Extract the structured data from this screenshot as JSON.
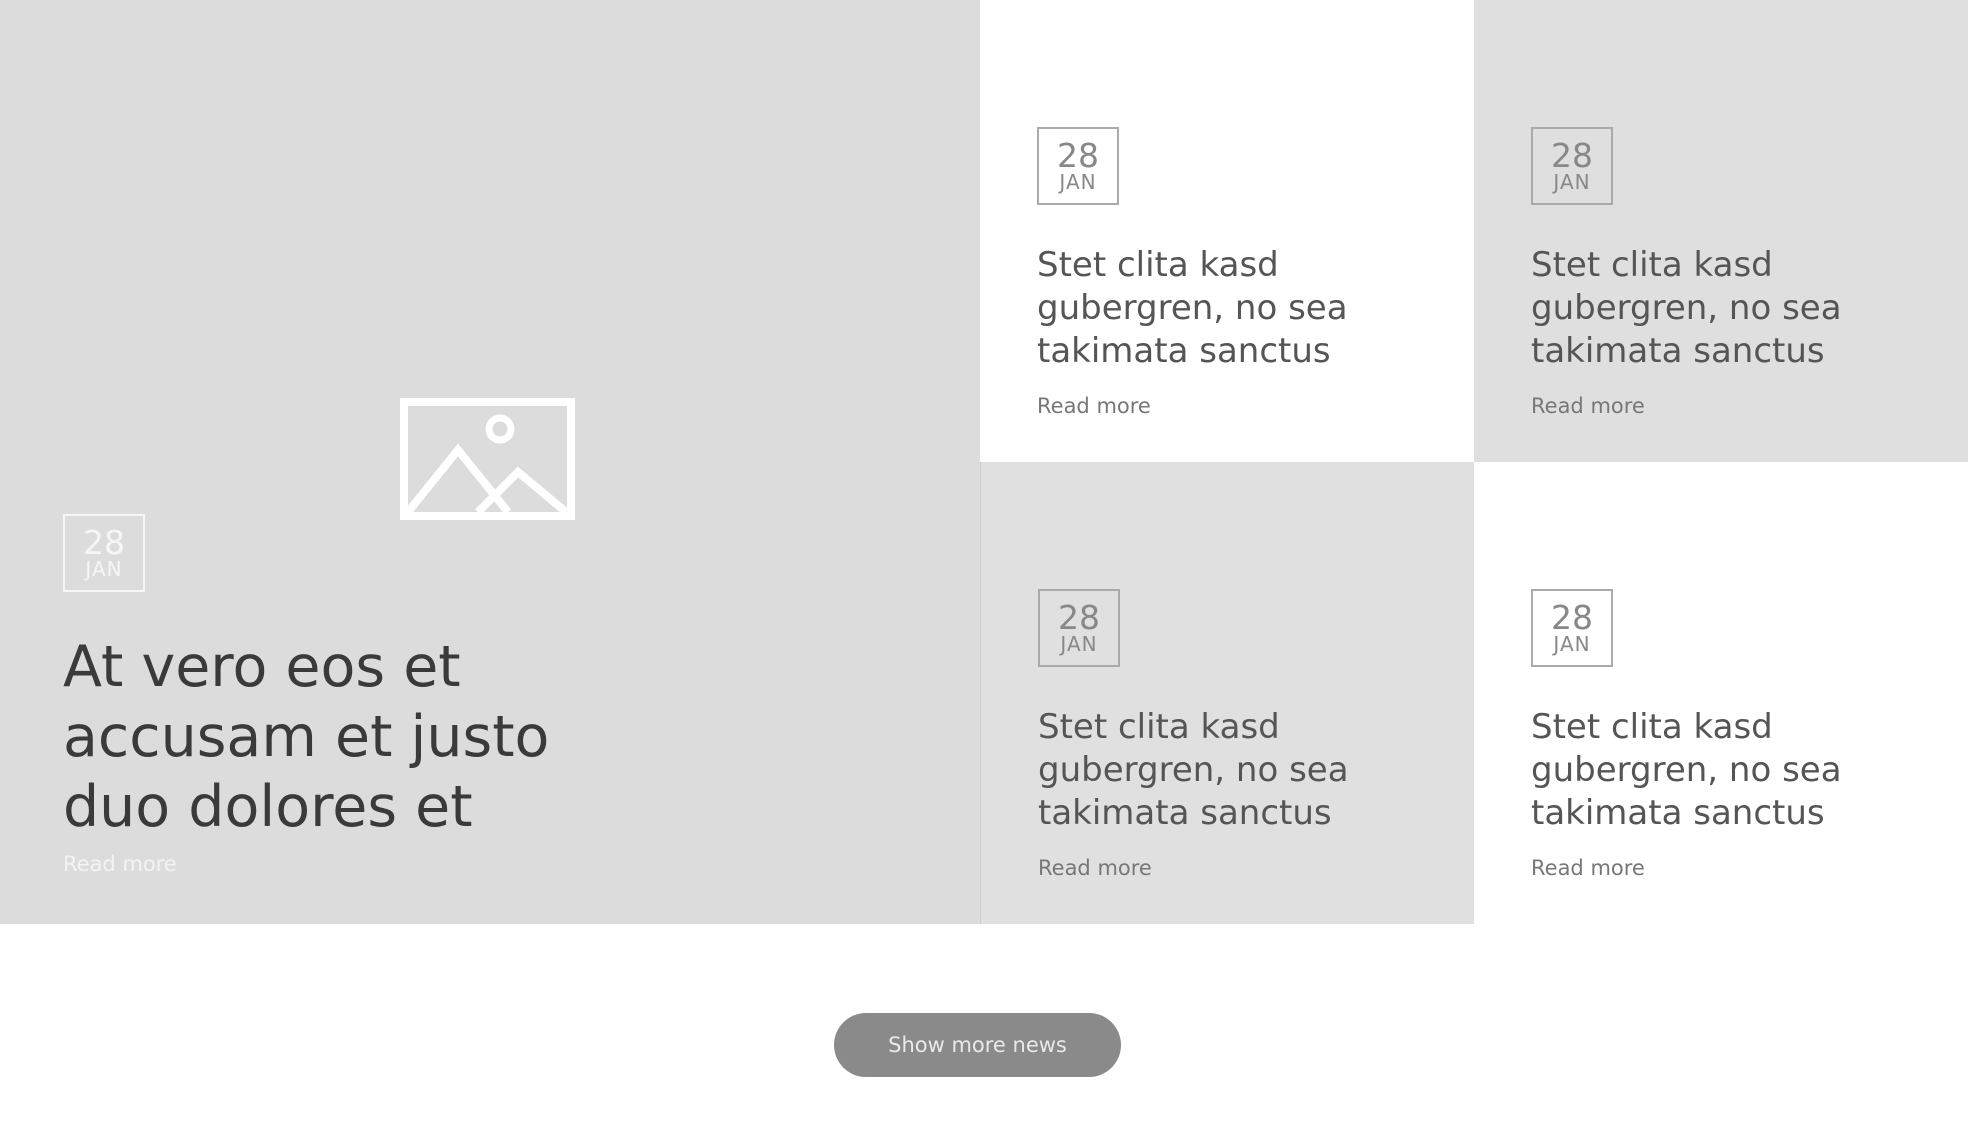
{
  "featured": {
    "image_icon": "image-placeholder-icon",
    "date": {
      "day": "28",
      "month": "JAN"
    },
    "headline": "At vero eos et accusam et justo duo dolores et",
    "read_more": "Read more"
  },
  "cards": [
    {
      "date": {
        "day": "28",
        "month": "JAN"
      },
      "headline": "Stet clita kasd gubergren, no sea takimata sanctus",
      "read_more": "Read more"
    },
    {
      "date": {
        "day": "28",
        "month": "JAN"
      },
      "headline": "Stet clita kasd gubergren, no sea takimata sanctus",
      "read_more": "Read more"
    },
    {
      "date": {
        "day": "28",
        "month": "JAN"
      },
      "headline": "Stet clita kasd gubergren, no sea takimata sanctus",
      "read_more": "Read more"
    },
    {
      "date": {
        "day": "28",
        "month": "JAN"
      },
      "headline": "Stet clita kasd gubergren, no sea takimata sanctus",
      "read_more": "Read more"
    }
  ],
  "show_more_button": "Show more news",
  "colors": {
    "button_background": "#8a8a8a",
    "tile_gray": "#dcdcdc",
    "tile_white": "#ffffff"
  }
}
